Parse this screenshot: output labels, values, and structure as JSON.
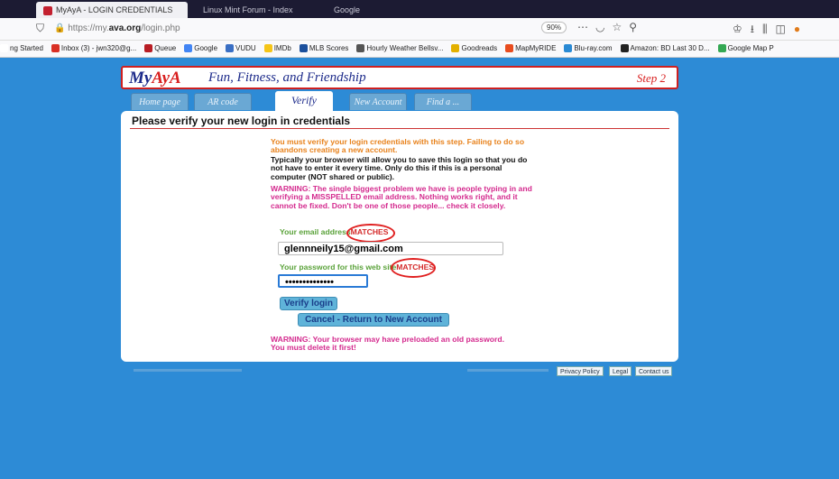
{
  "browser": {
    "active_tab": "MyAyA - LOGIN CREDENTIALS",
    "other_tab_1": "Linux Mint Forum - Index",
    "other_tab_2": "Google",
    "url_prefix": "https://my.",
    "url_domain": "ava.org",
    "url_path": "/login.php",
    "zoom": "90%"
  },
  "bookmarks": [
    {
      "label": "ng Started",
      "color": "#ffffff"
    },
    {
      "label": "Inbox (3) - jwn320@g...",
      "color": "#d93025"
    },
    {
      "label": "Queue",
      "color": "#b81d24"
    },
    {
      "label": "Google",
      "color": "#4285f4"
    },
    {
      "label": "VUDU",
      "color": "#3a6fc4"
    },
    {
      "label": "IMDb",
      "color": "#f5c518"
    },
    {
      "label": "MLB Scores",
      "color": "#1b4f9c"
    },
    {
      "label": "Hourly Weather Bellsv...",
      "color": "#555555"
    },
    {
      "label": "Goodreads",
      "color": "#e3b000"
    },
    {
      "label": "MapMyRIDE",
      "color": "#e84c1e"
    },
    {
      "label": "Blu-ray.com",
      "color": "#2a8ad4"
    },
    {
      "label": "Amazon: BD Last 30 D...",
      "color": "#222222"
    },
    {
      "label": "Google Map P",
      "color": "#34a853"
    }
  ],
  "site": {
    "logo_my": "My",
    "logo_aya": "AyA",
    "tagline": "Fun, Fitness, and Friendship",
    "step": "Step 2"
  },
  "nav_tabs": [
    {
      "label": "Home page"
    },
    {
      "label": "AR code"
    },
    {
      "label": "Verify"
    },
    {
      "label": "New Account"
    },
    {
      "label": "Find a ..."
    }
  ],
  "form": {
    "title": "Please verify your new login in credentials",
    "notice_orange": "You must verify your login credentials with this step. Failing to do so abandons creating a new account.",
    "notice_black": "Typically your browser will allow you to save this login so that you do not have to enter it every time. Only do this if this is a personal computer (NOT shared or public).",
    "notice_warning": "WARNING: The single biggest problem we have is people typing in and verifying a MISSPELLED email address. Nothing works right, and it cannot be fixed. Don't be one of those people... check it closely.",
    "email_label": "Your email address",
    "email_match": "MATCHES",
    "email_value": "glennneily15@gmail.com",
    "password_label": "Your password for this web site",
    "password_match": "MATCHES",
    "password_value": "••••••••••••••",
    "verify_button": "Verify login",
    "cancel_button": "Cancel - Return to New Account",
    "bottom_warning_1": "WARNING: Your browser may have preloaded an old password.",
    "bottom_warning_2": "You must delete it first!"
  },
  "footer": {
    "privacy": "Privacy Policy",
    "legal": "Legal",
    "contact": "Contact us"
  }
}
